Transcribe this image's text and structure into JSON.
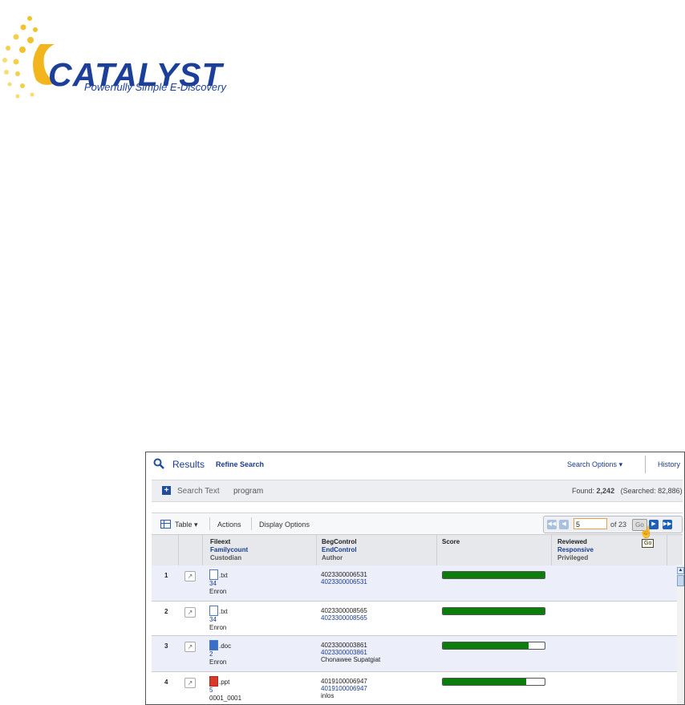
{
  "logo": {
    "name": "CATALYST",
    "tagline": "Powerfully Simple E-Discovery"
  },
  "header": {
    "results_label": "Results",
    "refine_label": "Refine Search",
    "search_options_label": "Search Options",
    "history_label": "History"
  },
  "search": {
    "label": "Search Text",
    "term": "program",
    "found_label": "Found:",
    "found_count": "2,242",
    "searched_text": "(Searched: 82,886)"
  },
  "toolbar": {
    "table_label": "Table",
    "actions_label": "Actions",
    "display_options_label": "Display Options"
  },
  "pager": {
    "current_page": "5",
    "of_text": "of 23",
    "go_label": "Go",
    "tooltip": "Go"
  },
  "columns": {
    "c1": {
      "top": "Fileext",
      "mid": "Familycount",
      "bot": "Custodian"
    },
    "c2": {
      "top": "BegControl",
      "mid": "EndControl",
      "bot": "Author"
    },
    "c3": {
      "top": "Score"
    },
    "c4": {
      "top": "Reviewed",
      "mid": "Responsive",
      "bot": "Privileged"
    }
  },
  "rows": [
    {
      "num": "1",
      "ext": ".txt",
      "icon": "text-file-icon",
      "familycount": "34",
      "custodian": "Enron",
      "beg": "4023300006531",
      "end": "4023300006531",
      "author": "",
      "score": 1.0
    },
    {
      "num": "2",
      "ext": ".txt",
      "icon": "text-file-icon",
      "familycount": "34",
      "custodian": "Enron",
      "beg": "4023300008565",
      "end": "4023300008565",
      "author": "",
      "score": 1.0
    },
    {
      "num": "3",
      "ext": ".doc",
      "icon": "word-file-icon",
      "familycount": "2",
      "custodian": "Enron",
      "beg": "4023300003861",
      "end": "4023300003861",
      "author": "Chonawee Supatgiat",
      "score": 0.84
    },
    {
      "num": "4",
      "ext": ".ppt",
      "icon": "powerpoint-file-icon",
      "familycount": "5",
      "custodian": "0001_0001",
      "beg": "4019100006947",
      "end": "4019100006947",
      "author": "inlos",
      "score": 0.82
    }
  ],
  "colors": {
    "accent": "#1a3c8a",
    "score_fill": "#0a7d0a",
    "row_alt": "#eceefa",
    "logo_sun": "#f2c12e"
  }
}
